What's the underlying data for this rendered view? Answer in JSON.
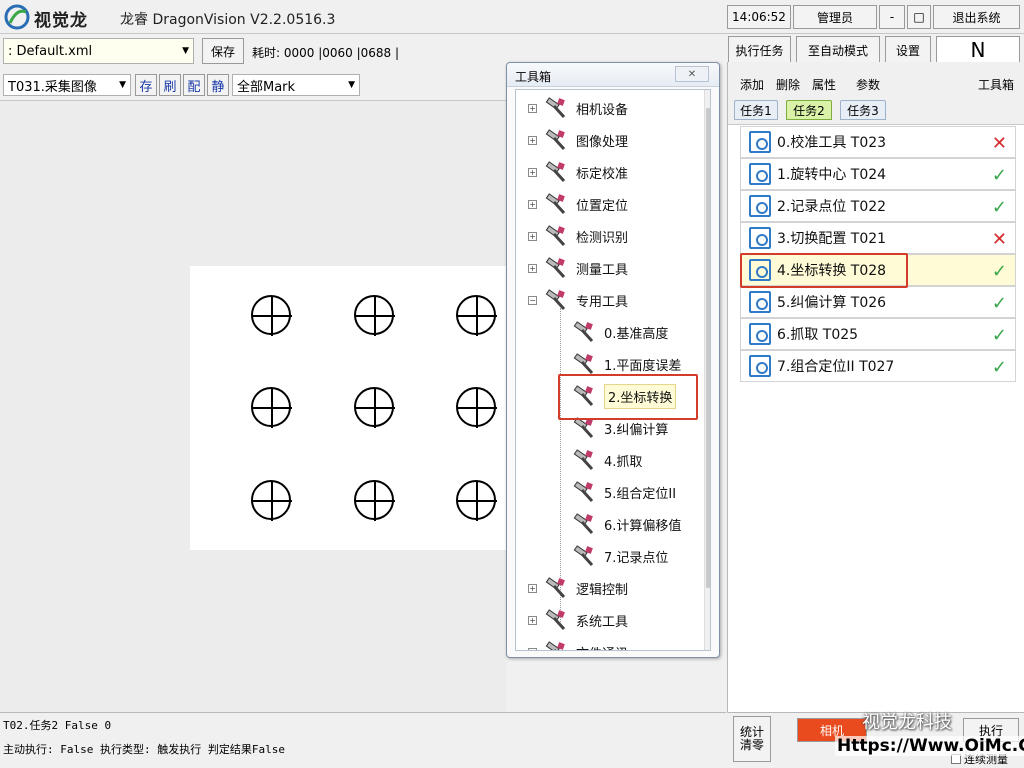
{
  "titlebar": {
    "logo_text": "视觉龙",
    "app_title": "龙睿 DragonVision V2.2.0516.3",
    "clock": "14:06:52",
    "user": "管理员",
    "minimize": "-",
    "maximize": "□",
    "exit": "退出系统"
  },
  "toolbar": {
    "config_file": ": Default.xml",
    "save": "保存",
    "timing": "耗时: 0000  |0060  |0688  |",
    "run_task": "执行任务",
    "auto_mode": "至自动模式",
    "settings": "设置",
    "mode_indicator": "N"
  },
  "image_bar": {
    "tool_select": "T031.采集图像",
    "btn_save": "存",
    "btn_refresh": "刷",
    "btn_config": "配",
    "btn_static": "静",
    "mark_select": "全部Mark"
  },
  "toolbox": {
    "title": "工具箱",
    "close": "✕",
    "categories": [
      {
        "label": "相机设备",
        "expander": "+"
      },
      {
        "label": "图像处理",
        "expander": "+"
      },
      {
        "label": "标定校准",
        "expander": "+"
      },
      {
        "label": "位置定位",
        "expander": "+"
      },
      {
        "label": "检测识别",
        "expander": "+"
      },
      {
        "label": "测量工具",
        "expander": "+"
      },
      {
        "label": "专用工具",
        "expander": "−"
      }
    ],
    "special_tools": [
      "0.基准高度",
      "1.平面度误差",
      "2.坐标转换",
      "3.纠偏计算",
      "4.抓取",
      "5.组合定位II",
      "6.计算偏移值",
      "7.记录点位"
    ],
    "selected_tool": "2.坐标转换",
    "more_categories": [
      {
        "label": "逻辑控制",
        "expander": "+"
      },
      {
        "label": "系统工具",
        "expander": "+"
      },
      {
        "label": "文件通讯",
        "expander": "+"
      }
    ]
  },
  "right_panel": {
    "menu": {
      "add": "添加",
      "delete": "删除",
      "props": "属性",
      "params": "参数",
      "toolbox": "工具箱"
    },
    "tabs": [
      "任务1",
      "任务2",
      "任务3"
    ],
    "active_tab": "任务2",
    "tasks": [
      {
        "label": "0.校准工具 T023",
        "status": "fail"
      },
      {
        "label": "1.旋转中心 T024",
        "status": "ok"
      },
      {
        "label": "2.记录点位 T022",
        "status": "ok"
      },
      {
        "label": "3.切换配置 T021",
        "status": "fail"
      },
      {
        "label": "4.坐标转换 T028",
        "status": "ok"
      },
      {
        "label": "5.纠偏计算 T026",
        "status": "ok"
      },
      {
        "label": "6.抓取 T025",
        "status": "ok"
      },
      {
        "label": "7.组合定位II T027",
        "status": "ok"
      }
    ],
    "highlighted_task": "4.坐标转换 T028",
    "ok_mark": "✓",
    "fail_mark": "✕",
    "stats_btn": "统计\n清零",
    "camera_btn": "相机",
    "run_btn": "执行",
    "continuous_label": "连续测量"
  },
  "status": {
    "line1": "T02.任务2  False 0",
    "line2": "主动执行: False 执行类型: 触发执行  判定结果False"
  },
  "watermark": {
    "name": "视觉龙科技",
    "url": "Https://Www.OiMc.Com"
  },
  "colors": {
    "ok": "#3aa84a",
    "fail": "#d42a2a",
    "highlight_box": "#d43c2a",
    "selected_row": "#fffbd6"
  }
}
